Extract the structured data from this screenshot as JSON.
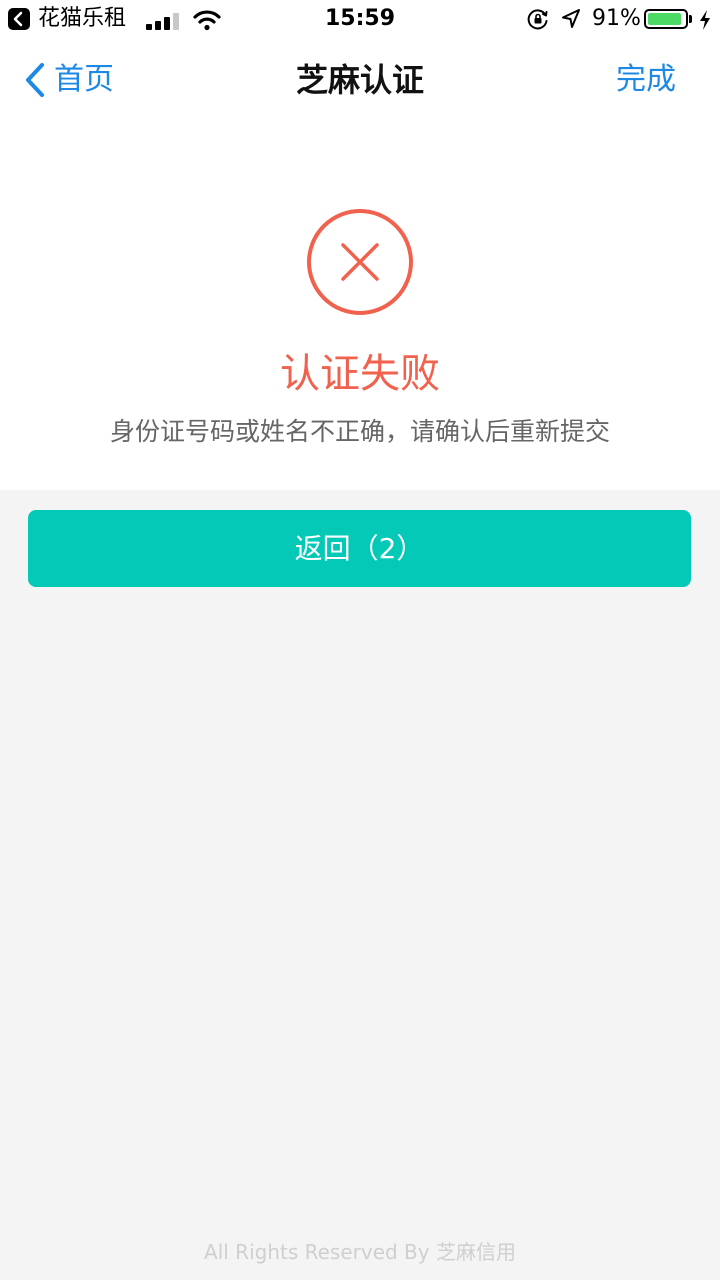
{
  "status_bar": {
    "app_name": "花猫乐租",
    "time": "15:59",
    "battery_percent": "91%",
    "battery_level": 0.91,
    "signal_bars": 3,
    "back_icon": "back-to-app-icon",
    "lock_icon": "orientation-lock-icon",
    "location_icon": "location-arrow-icon",
    "charging_icon": "charging-bolt-icon",
    "battery_color": "#4cd964"
  },
  "nav": {
    "back_label": "首页",
    "title": "芝麻认证",
    "done_label": "完成",
    "accent_color": "#1e88e5"
  },
  "result": {
    "icon": "fail-x-circle-icon",
    "title": "认证失败",
    "message": "身份证号码或姓名不正确，请确认后重新提交",
    "status_color": "#f0614e"
  },
  "actions": {
    "return_label": "返回（2）",
    "button_color": "#04c9b6"
  },
  "footer": {
    "text": "All Rights Reserved By 芝麻信用"
  }
}
